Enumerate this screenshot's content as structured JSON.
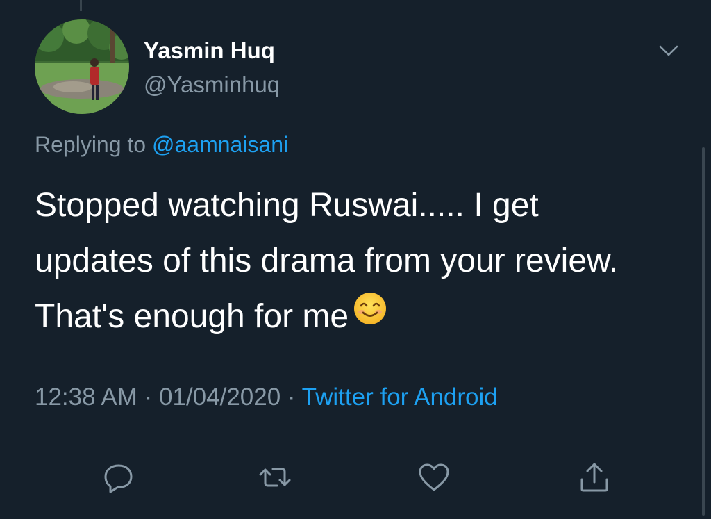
{
  "tweet": {
    "display_name": "Yasmin Huq",
    "handle": "@Yasminhuq",
    "replying_prefix": "Replying to ",
    "replying_to": "@aamnaisani",
    "text": "Stopped watching Ruswai..... I get updates of this drama from your review. That's enough for me",
    "emoji": "smiling-face-with-smiling-eyes",
    "time": "12:38 AM",
    "date": "01/04/2020",
    "separator": "·",
    "source": "Twitter for Android"
  },
  "actions": [
    "reply-icon",
    "retweet-icon",
    "like-icon",
    "share-icon"
  ],
  "colors": {
    "background": "#15202b",
    "text": "#ffffff",
    "secondary": "#8899a6",
    "accent": "#1da1f2",
    "divider": "#38444d"
  }
}
